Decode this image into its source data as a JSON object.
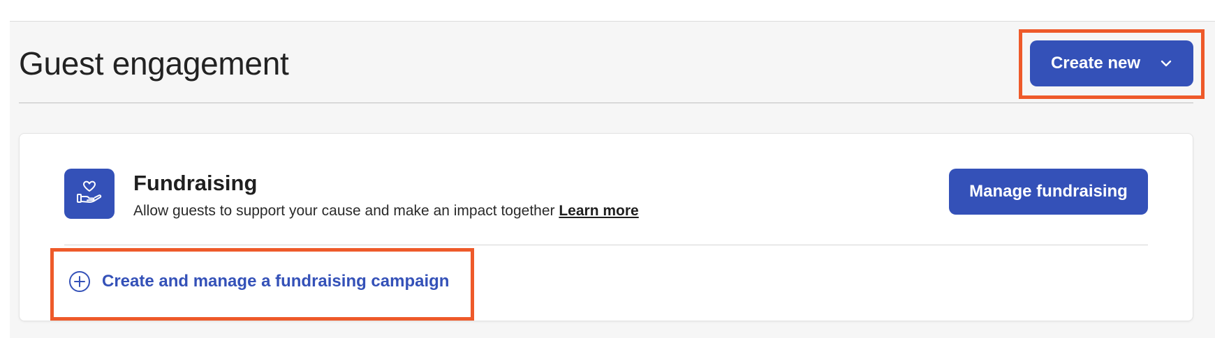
{
  "header": {
    "title": "Guest engagement",
    "create_new_label": "Create new"
  },
  "fundraising_card": {
    "title": "Fundraising",
    "description": "Allow guests to support your cause and make an impact together",
    "learn_more": "Learn more",
    "manage_button": "Manage fundraising",
    "campaign_link": "Create and manage a fundraising campaign"
  },
  "icons": {
    "tile_icon": "heart-hand-icon",
    "dropdown_icon": "chevron-down-icon",
    "campaign_icon": "plus-circle-icon"
  },
  "colors": {
    "primary": "#3451b8",
    "highlight": "#ee5a2a",
    "page_background": "#f6f6f6"
  }
}
